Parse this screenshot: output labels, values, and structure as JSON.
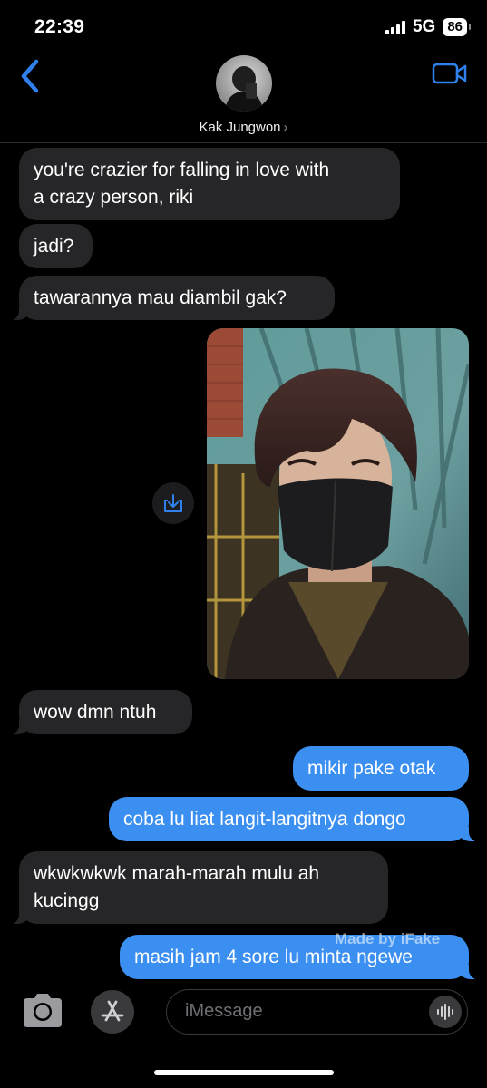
{
  "status_bar": {
    "time": "22:39",
    "network": "5G",
    "battery": "86"
  },
  "header": {
    "contact_name": "Kak Jungwon",
    "chevron": "›"
  },
  "messages": [
    {
      "from": "them",
      "text_lines": [
        "you're crazier for falling in love with",
        "a crazy person, riki"
      ]
    },
    {
      "from": "them",
      "text_lines": [
        "jadi?"
      ]
    },
    {
      "from": "them",
      "text_lines": [
        "tawarannya mau diambil gak?"
      ]
    },
    {
      "from": "me",
      "type": "photo"
    },
    {
      "from": "them",
      "text_lines": [
        "wow dmn ntuh"
      ]
    },
    {
      "from": "me",
      "text_lines": [
        "mikir pake otak"
      ]
    },
    {
      "from": "me",
      "text_lines": [
        "coba lu liat langit-langitnya dongo"
      ]
    },
    {
      "from": "them",
      "text_lines": [
        "wkwkwkwk marah-marah mulu ah",
        "kucingg"
      ]
    },
    {
      "from": "me",
      "text_lines": [
        "masih jam 4 sore lu minta ngewe"
      ]
    }
  ],
  "watermark": "Made by iFake",
  "input": {
    "placeholder": "iMessage"
  },
  "colors": {
    "incoming_bubble": "#262628",
    "outgoing_bubble": "#3b8ff1",
    "accent": "#2f80ed",
    "background": "#000000"
  },
  "icons": {
    "back": "chevron-left-icon",
    "video": "video-camera-icon",
    "save": "save-download-icon",
    "camera": "camera-icon",
    "apps": "app-store-icon",
    "mic": "audio-waveform-icon"
  }
}
